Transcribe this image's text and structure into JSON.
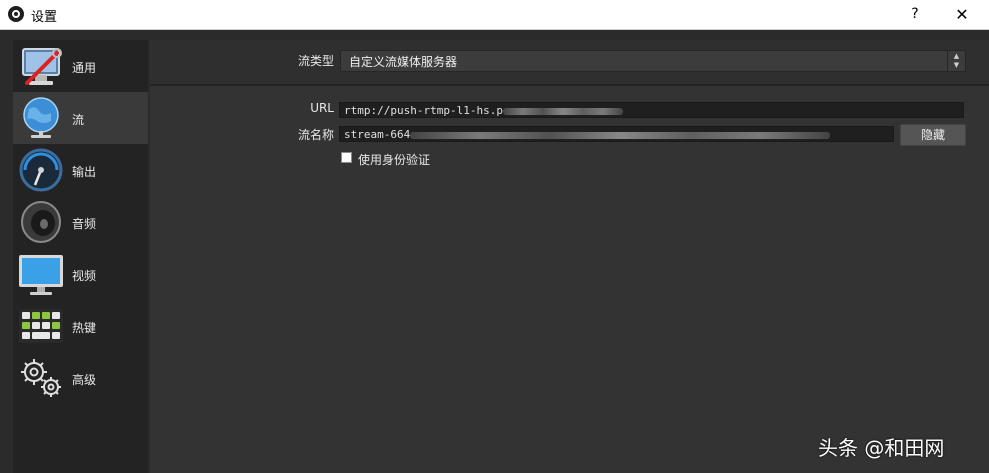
{
  "window": {
    "title": "设置",
    "help_label": "?",
    "close_label": "✕",
    "title_icon": "obs-logo-icon"
  },
  "sidebar": {
    "items": [
      {
        "label": "通用",
        "icon": "general-wrench-monitor-icon",
        "active": false
      },
      {
        "label": "流",
        "icon": "globe-stream-icon",
        "active": true
      },
      {
        "label": "输出",
        "icon": "output-gauge-icon",
        "active": false
      },
      {
        "label": "音频",
        "icon": "speaker-icon",
        "active": false
      },
      {
        "label": "视频",
        "icon": "monitor-icon",
        "active": false
      },
      {
        "label": "热键",
        "icon": "keyboard-icon",
        "active": false
      },
      {
        "label": "高级",
        "icon": "gears-icon",
        "active": false
      }
    ]
  },
  "stream": {
    "type_label": "流类型",
    "type_value": "自定义流媒体服务器",
    "url_label": "URL",
    "url_value": "rtmp://push-rtmp-l1-hs.p",
    "key_label": "流名称",
    "key_value": "stream-664",
    "hide_button": "隐藏",
    "auth_label": "使用身份验证",
    "auth_checked": false
  },
  "watermark": "头条 @和田网"
}
